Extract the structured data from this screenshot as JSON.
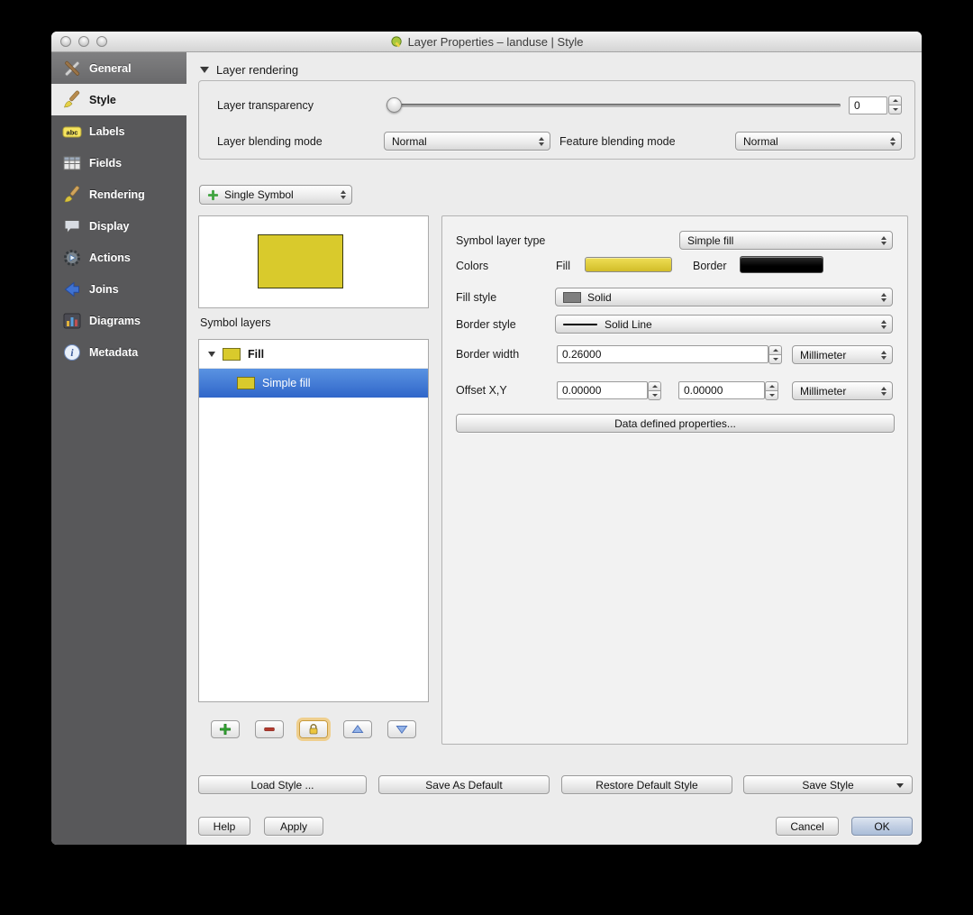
{
  "window": {
    "title": "Layer Properties – landuse | Style",
    "app_icon": "qgis-logo-icon"
  },
  "sidebar": {
    "items": [
      {
        "label": "General",
        "icon": "tools-icon"
      },
      {
        "label": "Style",
        "icon": "paintbrush-icon",
        "active": true
      },
      {
        "label": "Labels",
        "icon": "abc-label-icon"
      },
      {
        "label": "Fields",
        "icon": "table-icon"
      },
      {
        "label": "Rendering",
        "icon": "render-brush-icon"
      },
      {
        "label": "Display",
        "icon": "speech-bubble-icon"
      },
      {
        "label": "Actions",
        "icon": "gear-action-icon"
      },
      {
        "label": "Joins",
        "icon": "join-arrow-icon"
      },
      {
        "label": "Diagrams",
        "icon": "bar-chart-icon"
      },
      {
        "label": "Metadata",
        "icon": "info-icon"
      }
    ]
  },
  "layer_rendering": {
    "title": "Layer rendering",
    "transparency": {
      "label": "Layer transparency",
      "value": "0"
    },
    "layer_blending": {
      "label": "Layer blending mode",
      "value": "Normal"
    },
    "feature_blending": {
      "label": "Feature blending mode",
      "value": "Normal"
    }
  },
  "renderer": {
    "value": "Single Symbol",
    "icon": "single-symbol-icon"
  },
  "symbol_layers": {
    "label": "Symbol layers",
    "tree": [
      {
        "label": "Fill"
      },
      {
        "label": "Simple fill",
        "selected": true
      }
    ]
  },
  "properties": {
    "symbol_layer_type": {
      "label": "Symbol layer type",
      "value": "Simple fill"
    },
    "colors": {
      "label": "Colors",
      "fill_label": "Fill",
      "border_label": "Border",
      "fill_color": "#d9ca2c",
      "border_color": "#000000"
    },
    "fill_style": {
      "label": "Fill style",
      "value": "Solid"
    },
    "border_style": {
      "label": "Border style",
      "value": "Solid Line"
    },
    "border_width": {
      "label": "Border width",
      "value": "0.26000",
      "unit": "Millimeter"
    },
    "offset": {
      "label": "Offset X,Y",
      "x": "0.00000",
      "y": "0.00000",
      "unit": "Millimeter"
    },
    "data_defined_button": "Data defined properties..."
  },
  "style_actions": {
    "load_style": "Load Style ...",
    "save_as_default": "Save As Default",
    "restore_default": "Restore Default Style",
    "save_style": "Save Style"
  },
  "footer": {
    "help": "Help",
    "apply": "Apply",
    "cancel": "Cancel",
    "ok": "OK"
  },
  "theme": {
    "selection_blue": "#3b76d8",
    "sidebar_gray": "#58585a",
    "window_gray": "#ececec"
  }
}
